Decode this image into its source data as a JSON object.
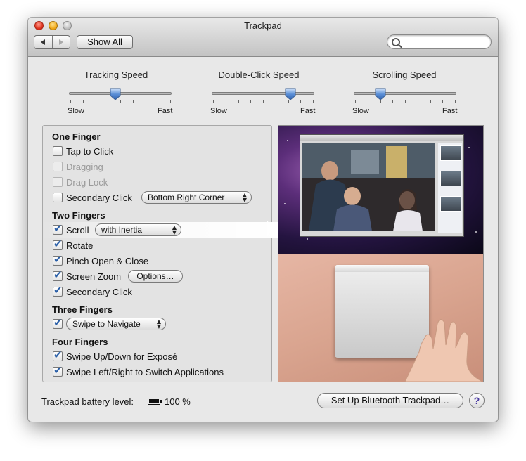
{
  "window": {
    "title": "Trackpad"
  },
  "toolbar": {
    "show_all_label": "Show All",
    "search_placeholder": "",
    "back_icon": "back-arrow-icon",
    "forward_icon": "forward-arrow-icon"
  },
  "sliders": [
    {
      "label": "Tracking Speed",
      "min_label": "Slow",
      "max_label": "Fast",
      "value_fraction": 0.45
    },
    {
      "label": "Double-Click Speed",
      "min_label": "Slow",
      "max_label": "Fast",
      "value_fraction": 0.77
    },
    {
      "label": "Scrolling Speed",
      "min_label": "Slow",
      "max_label": "Fast",
      "value_fraction": 0.26
    }
  ],
  "gestures": {
    "one_finger": {
      "heading": "One Finger",
      "items": [
        {
          "label": "Tap to Click",
          "checked": false,
          "enabled": true
        },
        {
          "label": "Dragging",
          "checked": false,
          "enabled": false
        },
        {
          "label": "Drag Lock",
          "checked": false,
          "enabled": false
        },
        {
          "label": "Secondary Click",
          "checked": false,
          "enabled": true,
          "popup": "Bottom Right Corner"
        }
      ]
    },
    "two_fingers": {
      "heading": "Two Fingers",
      "items": [
        {
          "label": "Scroll",
          "checked": true,
          "enabled": true,
          "popup": "with Inertia"
        },
        {
          "label": "Rotate",
          "checked": true,
          "enabled": true
        },
        {
          "label": "Pinch Open & Close",
          "checked": true,
          "enabled": true
        },
        {
          "label": "Screen Zoom",
          "checked": true,
          "enabled": true,
          "button": "Options…"
        },
        {
          "label": "Secondary Click",
          "checked": true,
          "enabled": true
        }
      ]
    },
    "three_fingers": {
      "heading": "Three Fingers",
      "items": [
        {
          "checked": true,
          "enabled": true,
          "popup": "Swipe to Navigate"
        }
      ]
    },
    "four_fingers": {
      "heading": "Four Fingers",
      "items": [
        {
          "label": "Swipe Up/Down for Exposé",
          "checked": true,
          "enabled": true
        },
        {
          "label": "Swipe Left/Right to Switch Applications",
          "checked": true,
          "enabled": true
        }
      ]
    }
  },
  "footer": {
    "battery_label": "Trackpad battery level:",
    "battery_value": "100 %",
    "setup_button": "Set Up Bluetooth Trackpad…",
    "help_label": "?"
  },
  "colors": {
    "window_bg": "#e8e8e8",
    "checkmark": "#2a5fa8",
    "slider_thumb": "#5b8fd6",
    "help_question": "#4a3aa0"
  }
}
